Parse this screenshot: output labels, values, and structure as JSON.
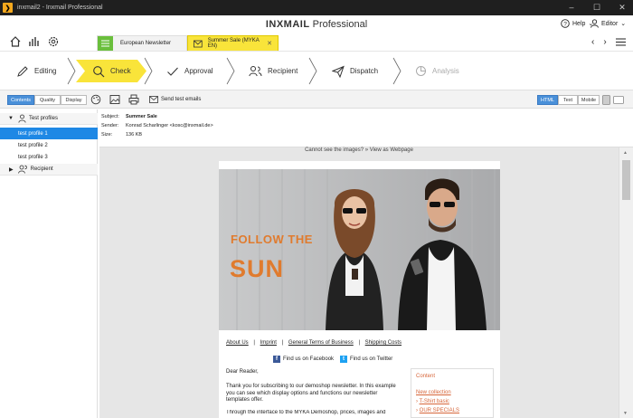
{
  "window": {
    "title": "inxmail2 - Inxmail Professional",
    "minimize": "–",
    "maximize": "☐",
    "close": "✕"
  },
  "brand": {
    "bold": "INXMAIL",
    "rest": " Professional"
  },
  "header": {
    "help_label": "Help",
    "editor_label": "Editor",
    "tabs": [
      {
        "label": "European Newsletter"
      },
      {
        "label": "Summer Sale (MYKA EN)",
        "close": "✕"
      }
    ]
  },
  "workflow": {
    "steps": [
      {
        "label": "Editing"
      },
      {
        "label": "Check"
      },
      {
        "label": "Approval"
      },
      {
        "label": "Recipient"
      },
      {
        "label": "Dispatch"
      },
      {
        "label": "Analysis"
      }
    ]
  },
  "toolbar": {
    "view_tabs": [
      "Contents",
      "Quality",
      "Display"
    ],
    "send_test": "Send test emails",
    "format_tabs": [
      "HTML",
      "Text",
      "Mobile"
    ]
  },
  "tree": {
    "test_profiles": "Test profiles",
    "profiles": [
      "test profile 1",
      "test profile 2",
      "test profile 3"
    ],
    "recipient": "Recipient"
  },
  "info": {
    "subject_key": "Subject:",
    "subject": "Summer Sale",
    "sender_key": "Sender:",
    "sender": "Konrad Scharlinger <kosc@inxmail.de>",
    "size_key": "Size:",
    "size": "136 KB"
  },
  "email": {
    "cannot_see": "Cannot see the images? » View as Webpage",
    "hero_line1": "FOLLOW THE",
    "hero_line2": "SUN",
    "links": [
      "About Us",
      "Imprint",
      "General Terms of Business",
      "Shipping Costs"
    ],
    "link_sep": "|",
    "facebook": "Find us on Facebook",
    "twitter": "Find us on Twitter",
    "greeting": "Dear Reader,",
    "para1": "Thank you for subscribing to our demoshop newsletter. In this example you can see which display options and functions our newsletter templates offer.",
    "para2": "Through the interface to the MYKA Demoshop, prices, images and",
    "sidebox_title": "Content",
    "sidebox_link1": "New collection",
    "sidebox_link2": "T-Shirt basic",
    "sidebox_link3": "OUR SPECIALS"
  },
  "colors": {
    "accent_blue": "#1e88e5",
    "check_yellow": "#f9e43a",
    "hero_orange": "#e07b2e",
    "link_orange": "#d7663a"
  }
}
